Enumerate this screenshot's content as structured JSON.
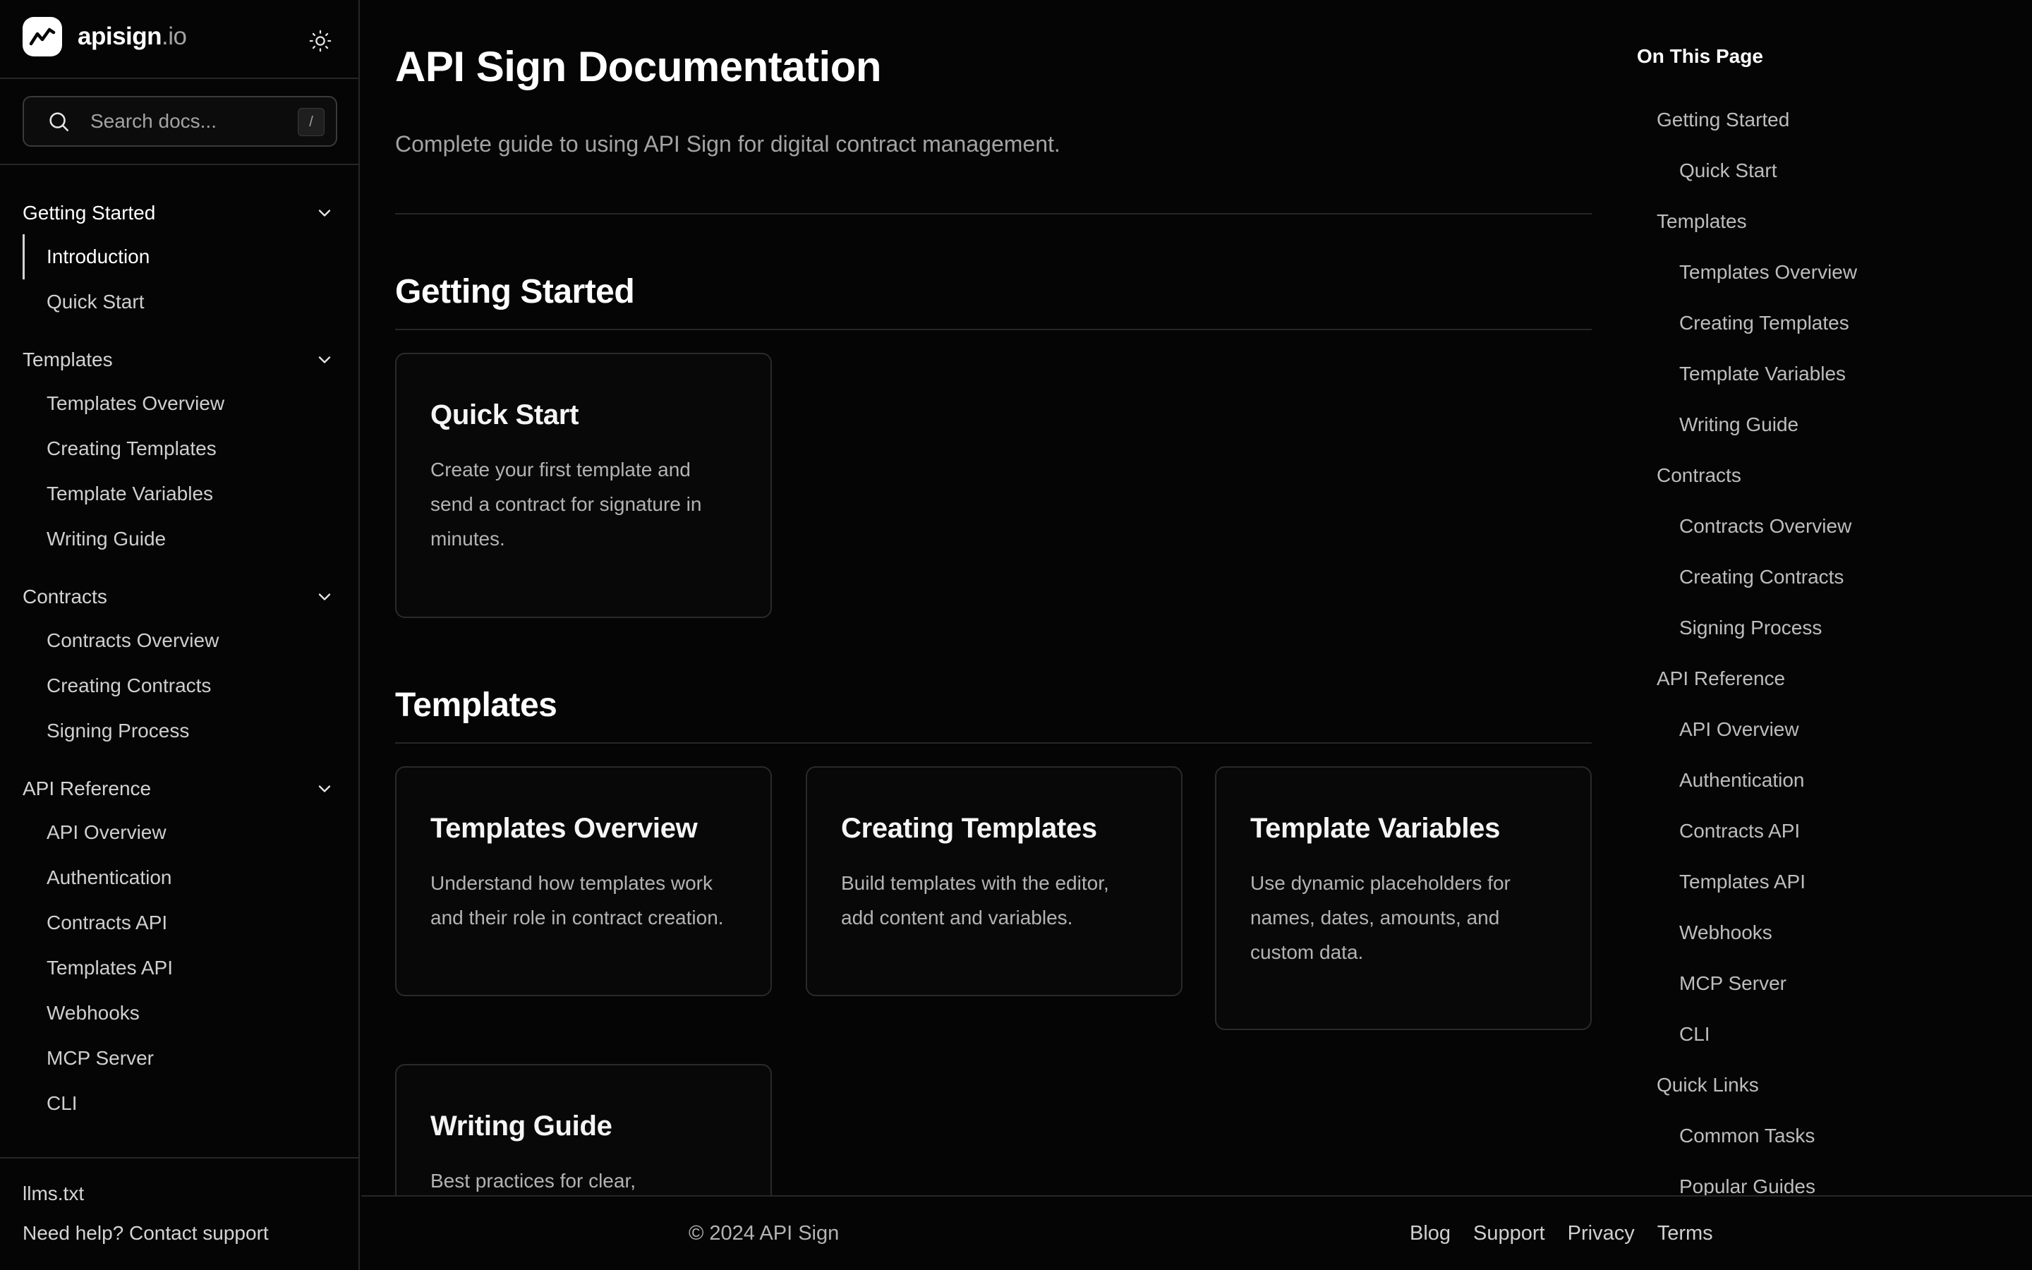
{
  "brand": {
    "name": "apisign",
    "tld": ".io"
  },
  "search": {
    "placeholder": "Search docs...",
    "shortcut": "/"
  },
  "sidebar": {
    "groups": [
      {
        "label": "Getting Started",
        "items": [
          "Introduction",
          "Quick Start"
        ]
      },
      {
        "label": "Templates",
        "items": [
          "Templates Overview",
          "Creating Templates",
          "Template Variables",
          "Writing Guide"
        ]
      },
      {
        "label": "Contracts",
        "items": [
          "Contracts Overview",
          "Creating Contracts",
          "Signing Process"
        ]
      },
      {
        "label": "API Reference",
        "items": [
          "API Overview",
          "Authentication",
          "Contracts API",
          "Templates API",
          "Webhooks",
          "MCP Server",
          "CLI"
        ]
      }
    ],
    "footer": {
      "llms": "llms.txt",
      "help": "Need help? Contact support"
    }
  },
  "main": {
    "title": "API Sign Documentation",
    "lead": "Complete guide to using API Sign for digital contract management.",
    "sections": [
      {
        "title": "Getting Started",
        "cards": [
          {
            "title": "Quick Start",
            "desc": "Create your first template and send a contract for signature in minutes."
          }
        ]
      },
      {
        "title": "Templates",
        "cards": [
          {
            "title": "Templates Overview",
            "desc": "Understand how templates work and their role in contract creation."
          },
          {
            "title": "Creating Templates",
            "desc": "Build templates with the editor, add content and variables."
          },
          {
            "title": "Template Variables",
            "desc": "Use dynamic placeholders for names, dates, amounts, and custom data."
          },
          {
            "title": "Writing Guide",
            "desc": "Best practices for clear,"
          }
        ]
      }
    ]
  },
  "toc": {
    "title": "On This Page",
    "items": [
      {
        "label": "Getting Started",
        "level": 1
      },
      {
        "label": "Quick Start",
        "level": 2
      },
      {
        "label": "Templates",
        "level": 1
      },
      {
        "label": "Templates Overview",
        "level": 2
      },
      {
        "label": "Creating Templates",
        "level": 2
      },
      {
        "label": "Template Variables",
        "level": 2
      },
      {
        "label": "Writing Guide",
        "level": 2
      },
      {
        "label": "Contracts",
        "level": 1
      },
      {
        "label": "Contracts Overview",
        "level": 2
      },
      {
        "label": "Creating Contracts",
        "level": 2
      },
      {
        "label": "Signing Process",
        "level": 2
      },
      {
        "label": "API Reference",
        "level": 1
      },
      {
        "label": "API Overview",
        "level": 2
      },
      {
        "label": "Authentication",
        "level": 2
      },
      {
        "label": "Contracts API",
        "level": 2
      },
      {
        "label": "Templates API",
        "level": 2
      },
      {
        "label": "Webhooks",
        "level": 2
      },
      {
        "label": "MCP Server",
        "level": 2
      },
      {
        "label": "CLI",
        "level": 2
      },
      {
        "label": "Quick Links",
        "level": 1
      },
      {
        "label": "Common Tasks",
        "level": 2
      },
      {
        "label": "Popular Guides",
        "level": 2
      }
    ]
  },
  "footer": {
    "copyright": "© 2024 API Sign",
    "links": [
      "Blog",
      "Support",
      "Privacy",
      "Terms"
    ]
  },
  "icons": {
    "logo": "trend-line-icon",
    "theme": "sun-icon",
    "search": "search-icon",
    "chevron": "chevron-down-icon"
  }
}
